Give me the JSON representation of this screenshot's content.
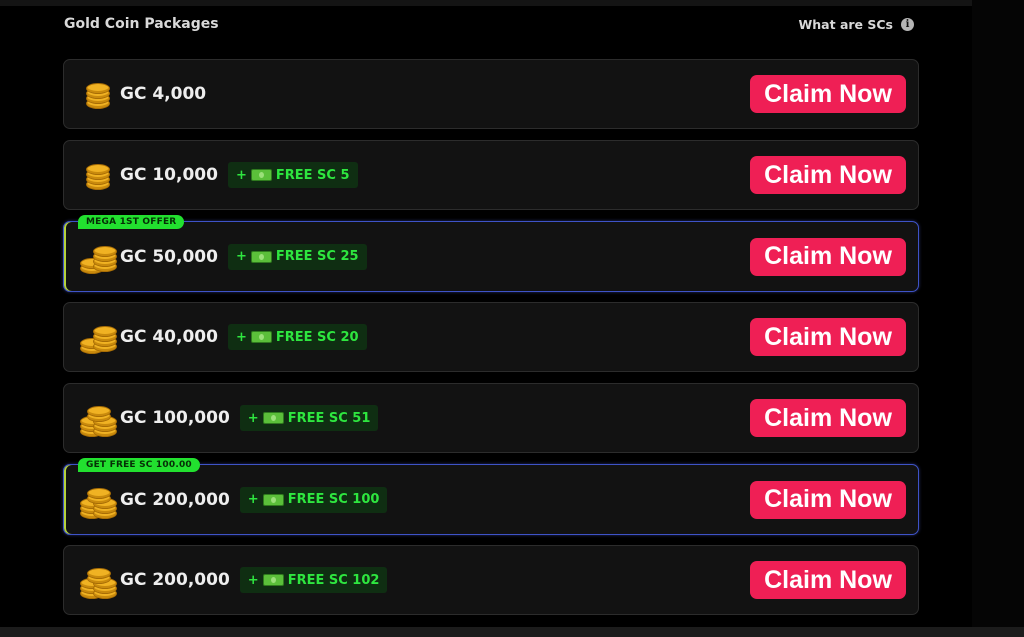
{
  "header": {
    "title": "Gold Coin Packages",
    "help_link": "What are SCs",
    "help_icon": "info-icon",
    "info_glyph": "i"
  },
  "colors": {
    "claim_button": "#ef1f55",
    "bonus_text": "#2ee63f",
    "ribbon": "#22e02f",
    "coin": "#f0b223"
  },
  "packages": [
    {
      "amount": "GC 4,000",
      "bonus": "",
      "ribbon": "",
      "claim_label": "Claim Now",
      "coin_icon": "gold-coin-stack-icon",
      "coin_stack_size": "small"
    },
    {
      "amount": "GC 10,000",
      "bonus_plus": "+",
      "bonus": "FREE SC 5",
      "ribbon": "",
      "claim_label": "Claim Now",
      "coin_icon": "gold-coin-stack-icon",
      "coin_stack_size": "small"
    },
    {
      "amount": "GC 50,000",
      "bonus_plus": "+",
      "bonus": "FREE SC 25",
      "ribbon": "MEGA 1ST OFFER",
      "claim_label": "Claim Now",
      "coin_icon": "gold-coin-stack-icon",
      "coin_stack_size": "medium"
    },
    {
      "amount": "GC 40,000",
      "bonus_plus": "+",
      "bonus": "FREE SC 20",
      "ribbon": "",
      "claim_label": "Claim Now",
      "coin_icon": "gold-coin-stack-icon",
      "coin_stack_size": "medium"
    },
    {
      "amount": "GC 100,000",
      "bonus_plus": "+",
      "bonus": "FREE SC 51",
      "ribbon": "",
      "claim_label": "Claim Now",
      "coin_icon": "gold-coin-stack-icon",
      "coin_stack_size": "large"
    },
    {
      "amount": "GC 200,000",
      "bonus_plus": "+",
      "bonus": "FREE SC 100",
      "ribbon": "GET FREE SC 100.00",
      "claim_label": "Claim Now",
      "coin_icon": "gold-coin-stack-icon",
      "coin_stack_size": "large"
    },
    {
      "amount": "GC 200,000",
      "bonus_plus": "+",
      "bonus": "FREE SC 102",
      "ribbon": "",
      "claim_label": "Claim Now",
      "coin_icon": "gold-coin-stack-icon",
      "coin_stack_size": "large"
    }
  ]
}
